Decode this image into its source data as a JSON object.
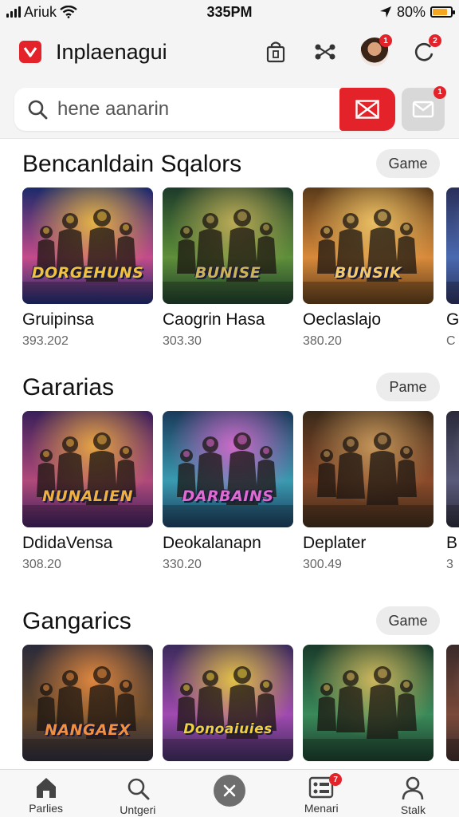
{
  "status_bar": {
    "carrier": "Ariuk",
    "time": "335PM",
    "battery": "80%",
    "battery_level": 0.8,
    "icons": [
      "signal-icon",
      "wifi-icon",
      "location-arrow-icon",
      "battery-icon"
    ]
  },
  "header": {
    "title": "Inplaenagui",
    "brand_color": "#e32329",
    "icons": [
      "bag-icon",
      "share-icon",
      "avatar",
      "refresh-icon"
    ],
    "avatar_badge": "1",
    "refresh_badge": "2"
  },
  "search": {
    "placeholder": "hene aanarin",
    "clear_icon": "close-icon",
    "message_icon": "mail-icon"
  },
  "sections": [
    {
      "title": "Bencanldain Sqalors",
      "chip": "Game",
      "cards": [
        {
          "name": "Gruipinsa",
          "meta": "393.202",
          "art_text": "DORGEHUNS"
        },
        {
          "name": "Caogrin Hasa",
          "meta": "303.30",
          "art_text": "BUNISE"
        },
        {
          "name": "Oeclaslajo",
          "meta": "380.20",
          "art_text": "BUNSIK"
        },
        {
          "name": "G",
          "meta": "C",
          "art_text": ""
        }
      ]
    },
    {
      "title": "Gararias",
      "chip": "Pame",
      "cards": [
        {
          "name": "DdidaVensa",
          "meta": "308.20",
          "art_text": "NUNALIEN"
        },
        {
          "name": "Deokalanapn",
          "meta": "330.20",
          "art_text": "DARBAINS"
        },
        {
          "name": "Deplater",
          "meta": "300.49",
          "art_text": ""
        },
        {
          "name": "B",
          "meta": "3",
          "art_text": ""
        }
      ]
    },
    {
      "title": "Gangarics",
      "chip": "Game",
      "cards": [
        {
          "name": "",
          "meta": "",
          "art_text": "NANGAEX"
        },
        {
          "name": "",
          "meta": "",
          "art_text": "Donoaiuies"
        },
        {
          "name": "",
          "meta": "",
          "art_text": ""
        },
        {
          "name": "",
          "meta": "",
          "art_text": ""
        }
      ]
    }
  ],
  "bottom_nav": [
    {
      "label": "Parlies",
      "icon": "home-icon"
    },
    {
      "label": "Untgeri",
      "icon": "search-icon"
    },
    {
      "label": "",
      "icon": "close-icon"
    },
    {
      "label": "Menari",
      "icon": "grid-icon",
      "badge": "7"
    },
    {
      "label": "Stalk",
      "icon": "profile-icon"
    }
  ]
}
